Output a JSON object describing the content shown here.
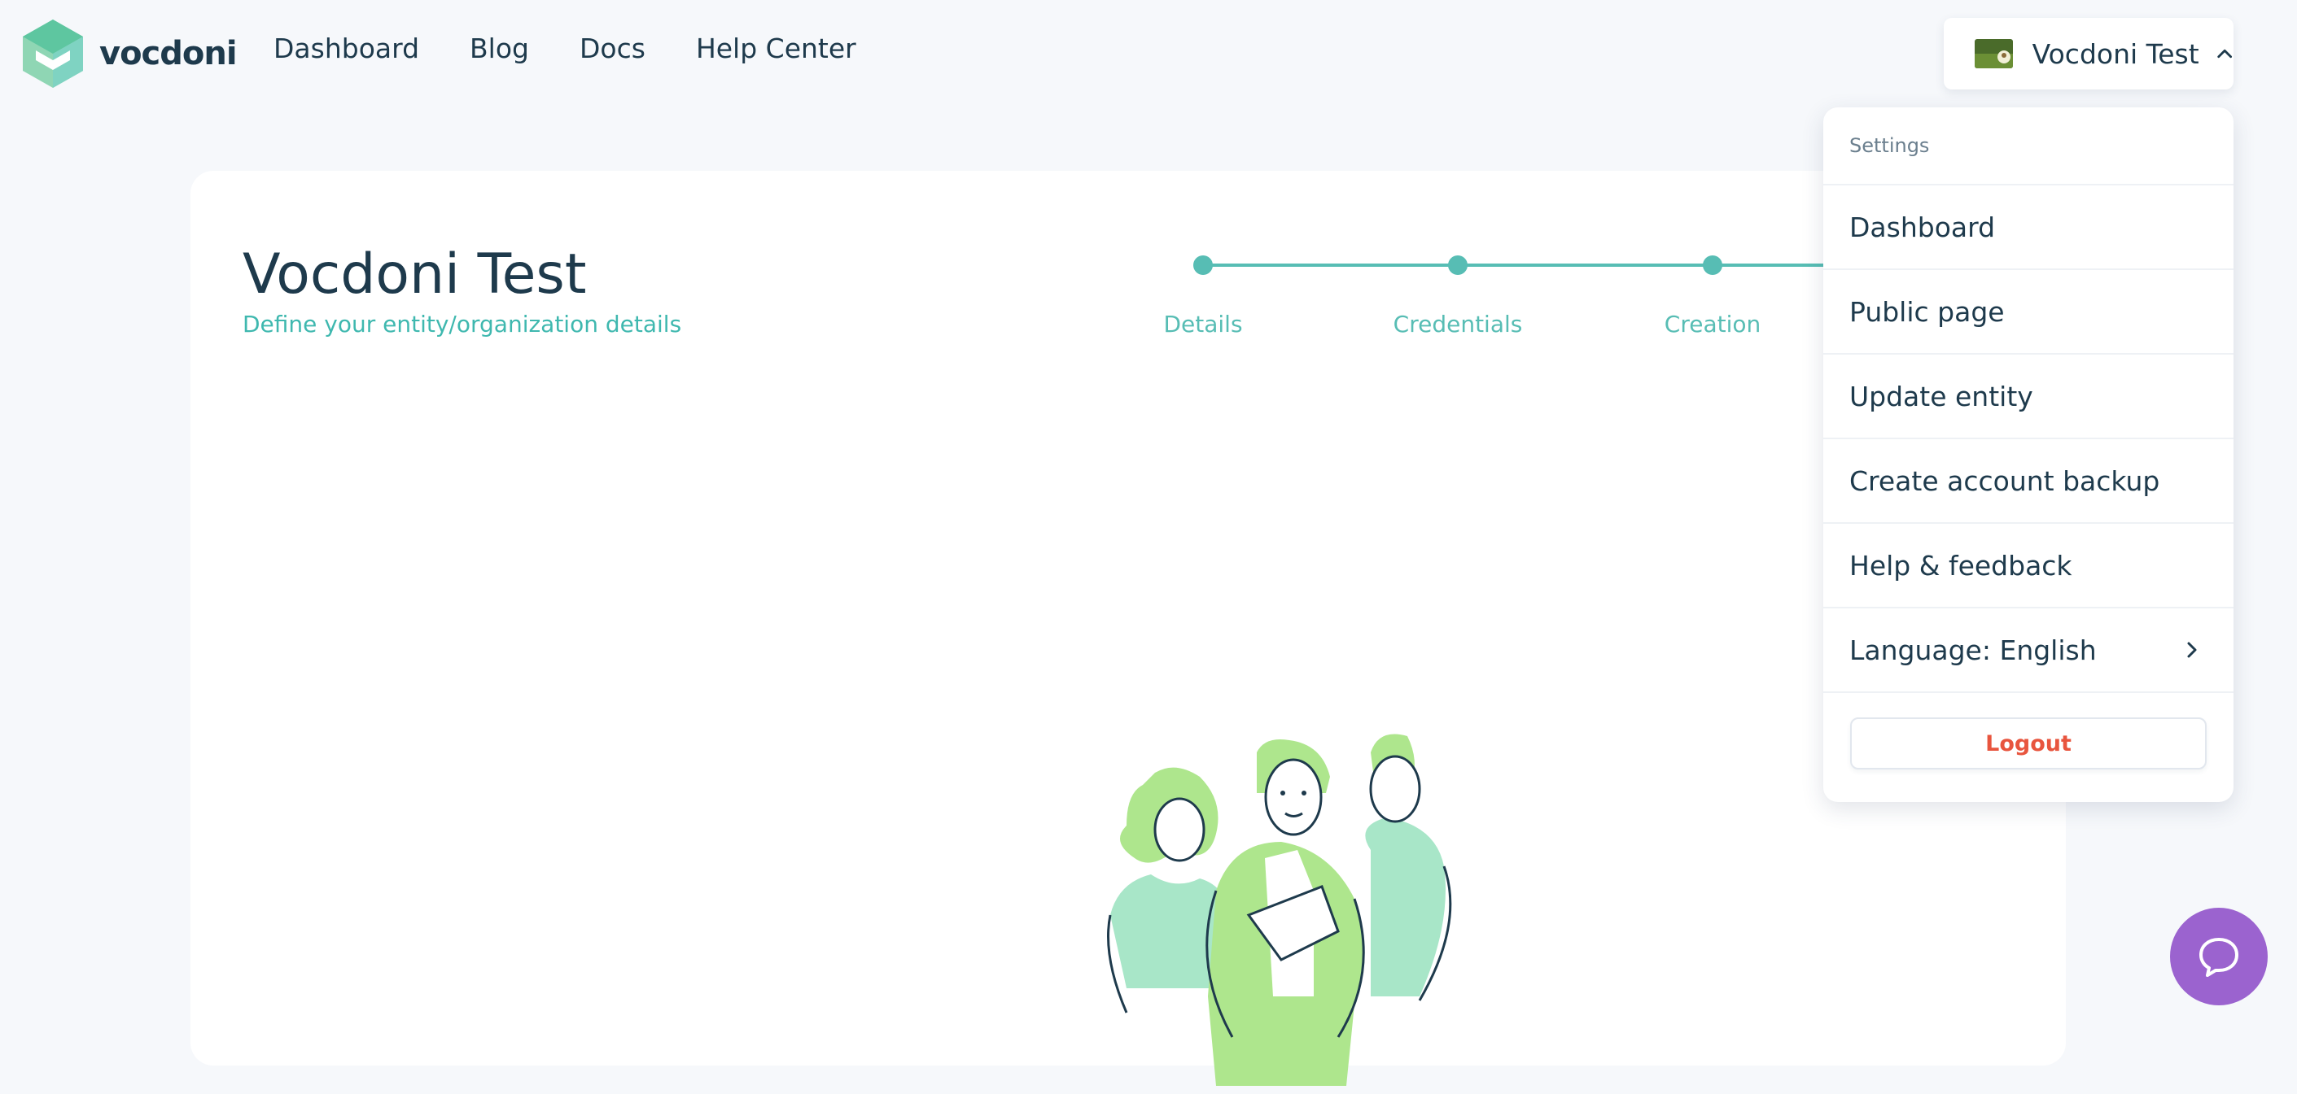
{
  "brand": {
    "name": "vocdoni",
    "colors": {
      "accent": "#57bdb4",
      "primary_text": "#1e3a4c",
      "danger": "#e8553e",
      "chat": "#9b63cf"
    }
  },
  "nav": {
    "links": [
      {
        "label": "Dashboard"
      },
      {
        "label": "Blog"
      },
      {
        "label": "Docs"
      },
      {
        "label": "Help Center"
      }
    ]
  },
  "user_menu": {
    "name": "Vocdoni Test",
    "icon": "chevron-up-icon"
  },
  "page": {
    "title": "Vocdoni Test",
    "subtitle": "Define your entity/organization details"
  },
  "stepper": {
    "steps": [
      {
        "label": "Details"
      },
      {
        "label": "Credentials"
      },
      {
        "label": "Creation"
      }
    ]
  },
  "dropdown": {
    "header": "Settings",
    "items": [
      {
        "label": "Dashboard"
      },
      {
        "label": "Public page"
      },
      {
        "label": "Update entity"
      },
      {
        "label": "Create account backup"
      },
      {
        "label": "Help & feedback"
      },
      {
        "label": "Language: English",
        "icon": "chevron-right-icon"
      }
    ],
    "logout_label": "Logout"
  },
  "chat": {
    "icon": "chat-bubble-icon"
  }
}
